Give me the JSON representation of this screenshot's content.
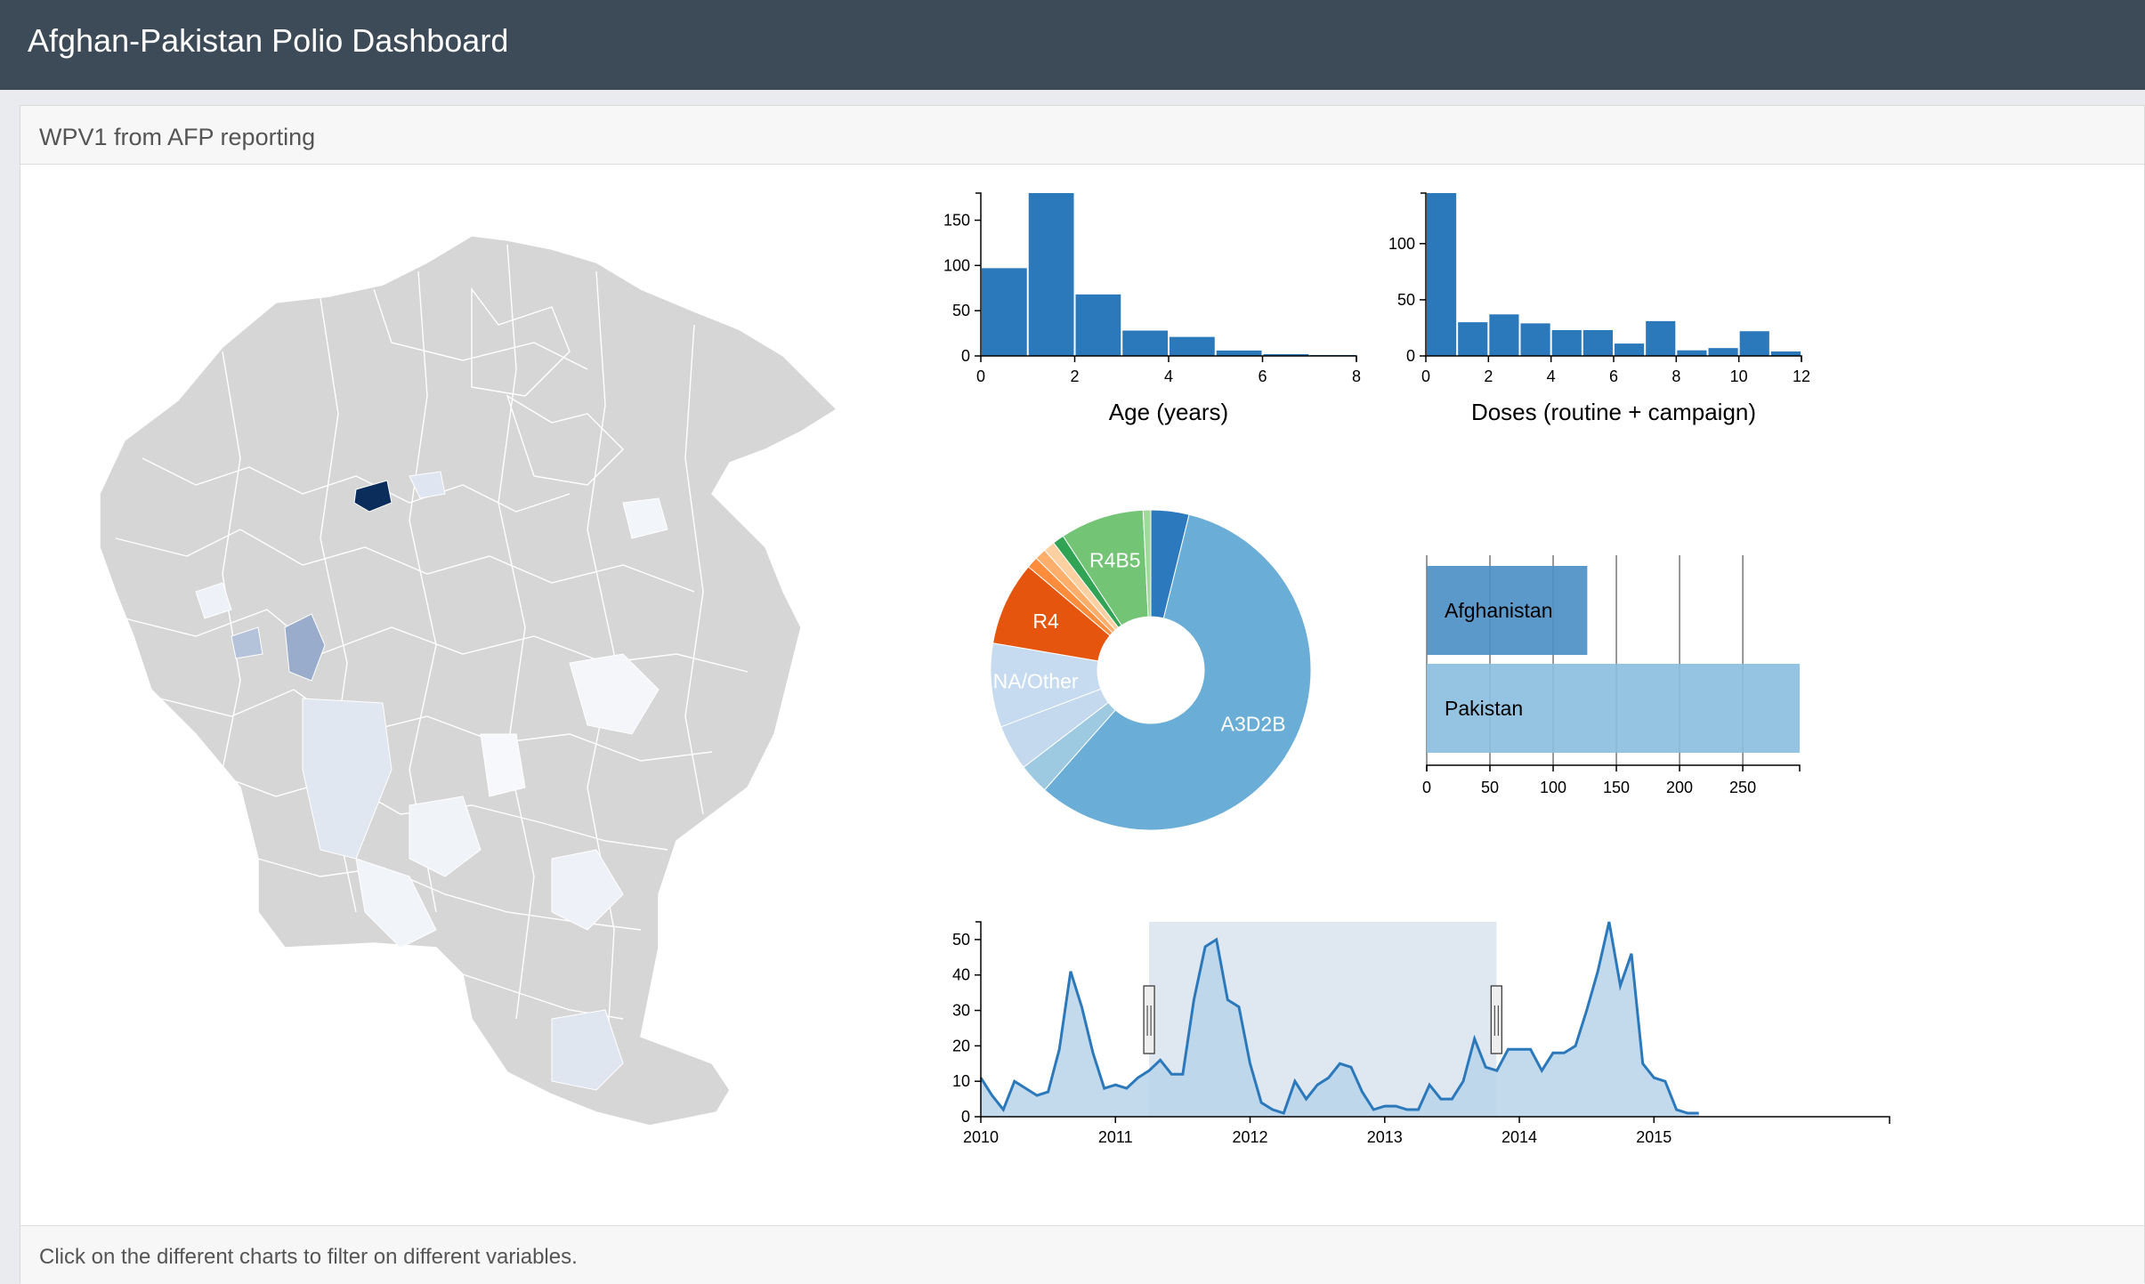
{
  "header": {
    "title": "Afghan-Pakistan Polio Dashboard"
  },
  "panel": {
    "title": "WPV1 from AFP reporting",
    "footer": "Click on the different charts to filter on different variables."
  },
  "colors": {
    "navbar": "#3d4b59",
    "bar": "#2b78bb",
    "area_fill": "#b8d3ea",
    "area_line": "#2b78bb",
    "brush": "#dfe7f1",
    "map_base": "#d6d6d6",
    "map_highlight": "#0b2d5b"
  },
  "chart_data": [
    {
      "id": "age",
      "type": "bar",
      "xlabel": "Age (years)",
      "ylabel": "",
      "xlim": [
        0,
        8
      ],
      "ylim": [
        0,
        180
      ],
      "xticks": [
        0,
        2,
        4,
        6,
        8
      ],
      "yticks": [
        0,
        50,
        100,
        150
      ],
      "bin_width": 1,
      "bins": [
        0,
        1,
        2,
        3,
        4,
        5,
        6,
        7
      ],
      "values": [
        97,
        180,
        68,
        28,
        21,
        6,
        2,
        1
      ]
    },
    {
      "id": "doses",
      "type": "bar",
      "xlabel": "Doses (routine + campaign)",
      "ylabel": "",
      "xlim": [
        0,
        12
      ],
      "ylim": [
        0,
        145
      ],
      "xticks": [
        0,
        2,
        4,
        6,
        8,
        10,
        12
      ],
      "yticks": [
        0,
        50,
        100
      ],
      "bin_width": 1,
      "bins": [
        0,
        1,
        2,
        3,
        4,
        5,
        6,
        7,
        8,
        9,
        10,
        11
      ],
      "values": [
        145,
        30,
        37,
        29,
        23,
        23,
        11,
        31,
        5,
        7,
        22,
        4
      ]
    },
    {
      "id": "genotype",
      "type": "pie",
      "labels": [
        "",
        "A3D2B",
        "",
        "",
        "NA/Other",
        "R4",
        "",
        "",
        "",
        "",
        "R4B5",
        ""
      ],
      "values": [
        10,
        150,
        8,
        12,
        22,
        22,
        3,
        3,
        3,
        3,
        22,
        2
      ],
      "colors": [
        "#2c79bd",
        "#6aadd6",
        "#9ecae1",
        "#c5d9ee",
        "#c6dbef",
        "#e6550d",
        "#fd8d3c",
        "#fdae6b",
        "#fdd0a2",
        "#31a354",
        "#74c476",
        "#a1d99b"
      ]
    },
    {
      "id": "country",
      "type": "bar",
      "orientation": "horizontal",
      "categories": [
        "Afghanistan",
        "Pakistan"
      ],
      "values": [
        127,
        295
      ],
      "colors": [
        "#4d90c7",
        "#8bbfe0"
      ],
      "xlim": [
        0,
        295
      ],
      "xticks": [
        0,
        50,
        100,
        150,
        200,
        250
      ]
    },
    {
      "id": "timeline",
      "type": "area",
      "xlim": [
        2010,
        2016.75
      ],
      "ylim": [
        0,
        55
      ],
      "xticks": [
        2010,
        2011,
        2012,
        2013,
        2014,
        2015
      ],
      "yticks": [
        0,
        10,
        20,
        30,
        40,
        50
      ],
      "brush": [
        2011.25,
        2013.83
      ],
      "x": [
        2010.0,
        2010.083,
        2010.167,
        2010.25,
        2010.333,
        2010.417,
        2010.5,
        2010.583,
        2010.667,
        2010.75,
        2010.833,
        2010.917,
        2011.0,
        2011.083,
        2011.167,
        2011.25,
        2011.333,
        2011.417,
        2011.5,
        2011.583,
        2011.667,
        2011.75,
        2011.833,
        2011.917,
        2012.0,
        2012.083,
        2012.167,
        2012.25,
        2012.333,
        2012.417,
        2012.5,
        2012.583,
        2012.667,
        2012.75,
        2012.833,
        2012.917,
        2013.0,
        2013.083,
        2013.167,
        2013.25,
        2013.333,
        2013.417,
        2013.5,
        2013.583,
        2013.667,
        2013.75,
        2013.833,
        2013.917,
        2014.0,
        2014.083,
        2014.167,
        2014.25,
        2014.333,
        2014.417,
        2014.5,
        2014.583,
        2014.667,
        2014.75,
        2014.833,
        2014.917,
        2015.0,
        2015.083,
        2015.167,
        2015.25,
        2015.333
      ],
      "y": [
        11,
        6,
        2,
        10,
        8,
        6,
        7,
        19,
        41,
        31,
        18,
        8,
        9,
        8,
        11,
        13,
        16,
        12,
        12,
        33,
        48,
        50,
        33,
        31,
        15,
        4,
        2,
        1,
        10,
        5,
        9,
        11,
        15,
        14,
        7,
        2,
        3,
        3,
        2,
        2,
        9,
        5,
        5,
        10,
        22,
        14,
        13,
        19,
        19,
        19,
        13,
        18,
        18,
        20,
        30,
        41,
        55,
        37,
        46,
        15,
        11,
        10,
        2,
        1,
        1
      ]
    }
  ]
}
